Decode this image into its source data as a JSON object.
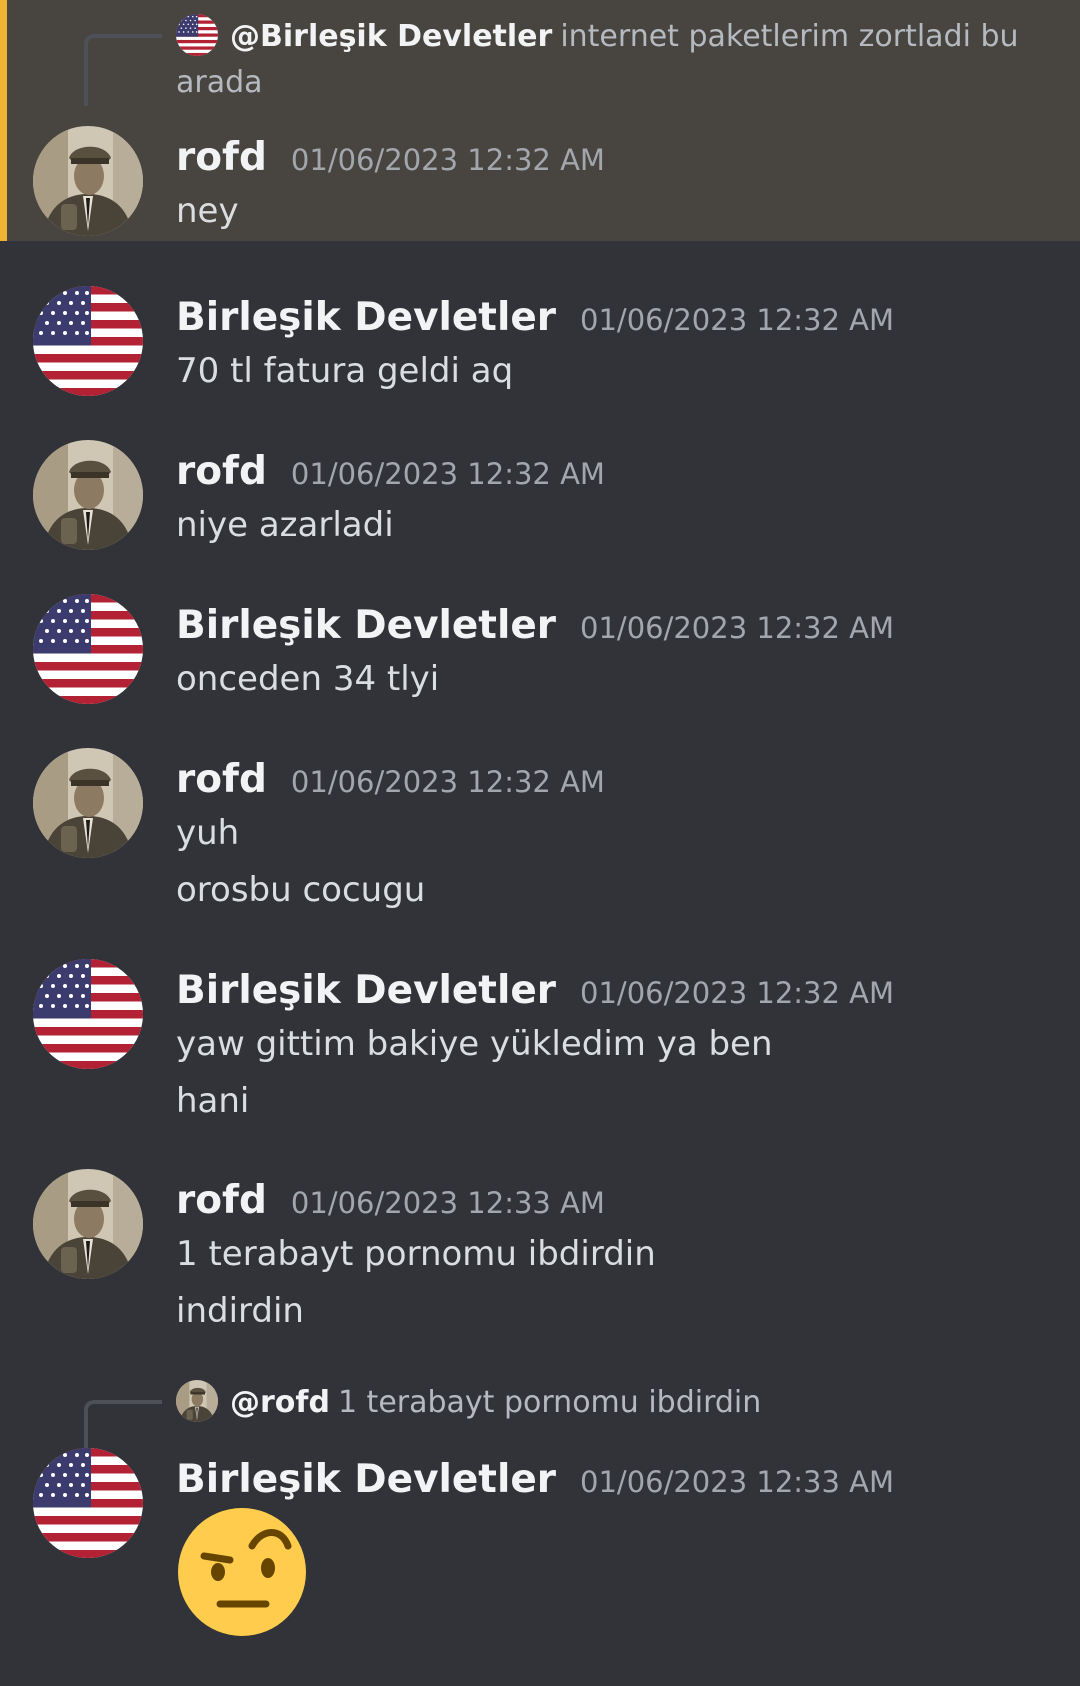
{
  "colors": {
    "background": "#313338",
    "highlight_background": "#48443f",
    "highlight_bar": "#f0b232",
    "username": "#f2f3f5",
    "timestamp": "#a2a6ad",
    "message_text": "#dbdee1",
    "reply_text": "#b5bac1"
  },
  "messages": [
    {
      "author": "rofd",
      "avatar": "soldier-portrait-avatar",
      "timestamp": "01/06/2023 12:32 AM",
      "highlighted": true,
      "reply": {
        "author": "@Birleşik Devletler",
        "avatar": "us-flag-avatar",
        "text": "internet paketlerim zortladi bu arada"
      },
      "lines": [
        "ney"
      ]
    },
    {
      "author": "Birleşik Devletler",
      "avatar": "us-flag-avatar",
      "timestamp": "01/06/2023 12:32 AM",
      "lines": [
        "70 tl fatura geldi aq"
      ]
    },
    {
      "author": "rofd",
      "avatar": "soldier-portrait-avatar",
      "timestamp": "01/06/2023 12:32 AM",
      "lines": [
        "niye azarladi"
      ]
    },
    {
      "author": "Birleşik Devletler",
      "avatar": "us-flag-avatar",
      "timestamp": "01/06/2023 12:32 AM",
      "lines": [
        "onceden 34 tlyi"
      ]
    },
    {
      "author": "rofd",
      "avatar": "soldier-portrait-avatar",
      "timestamp": "01/06/2023 12:32 AM",
      "lines": [
        "yuh",
        "orosbu cocugu"
      ]
    },
    {
      "author": "Birleşik Devletler",
      "avatar": "us-flag-avatar",
      "timestamp": "01/06/2023 12:32 AM",
      "lines": [
        "yaw gittim bakiye yükledim ya ben",
        "hani"
      ]
    },
    {
      "author": "rofd",
      "avatar": "soldier-portrait-avatar",
      "timestamp": "01/06/2023 12:33 AM",
      "lines": [
        "1 terabayt pornomu ibdirdin",
        "indirdin"
      ]
    },
    {
      "author": "Birleşik Devletler",
      "avatar": "us-flag-avatar",
      "timestamp": "01/06/2023 12:33 AM",
      "reply": {
        "author": "@rofd",
        "avatar": "soldier-portrait-avatar",
        "text": "1 terabayt pornomu ibdirdin"
      },
      "emoji": "face-with-raised-eyebrow-emoji"
    }
  ]
}
